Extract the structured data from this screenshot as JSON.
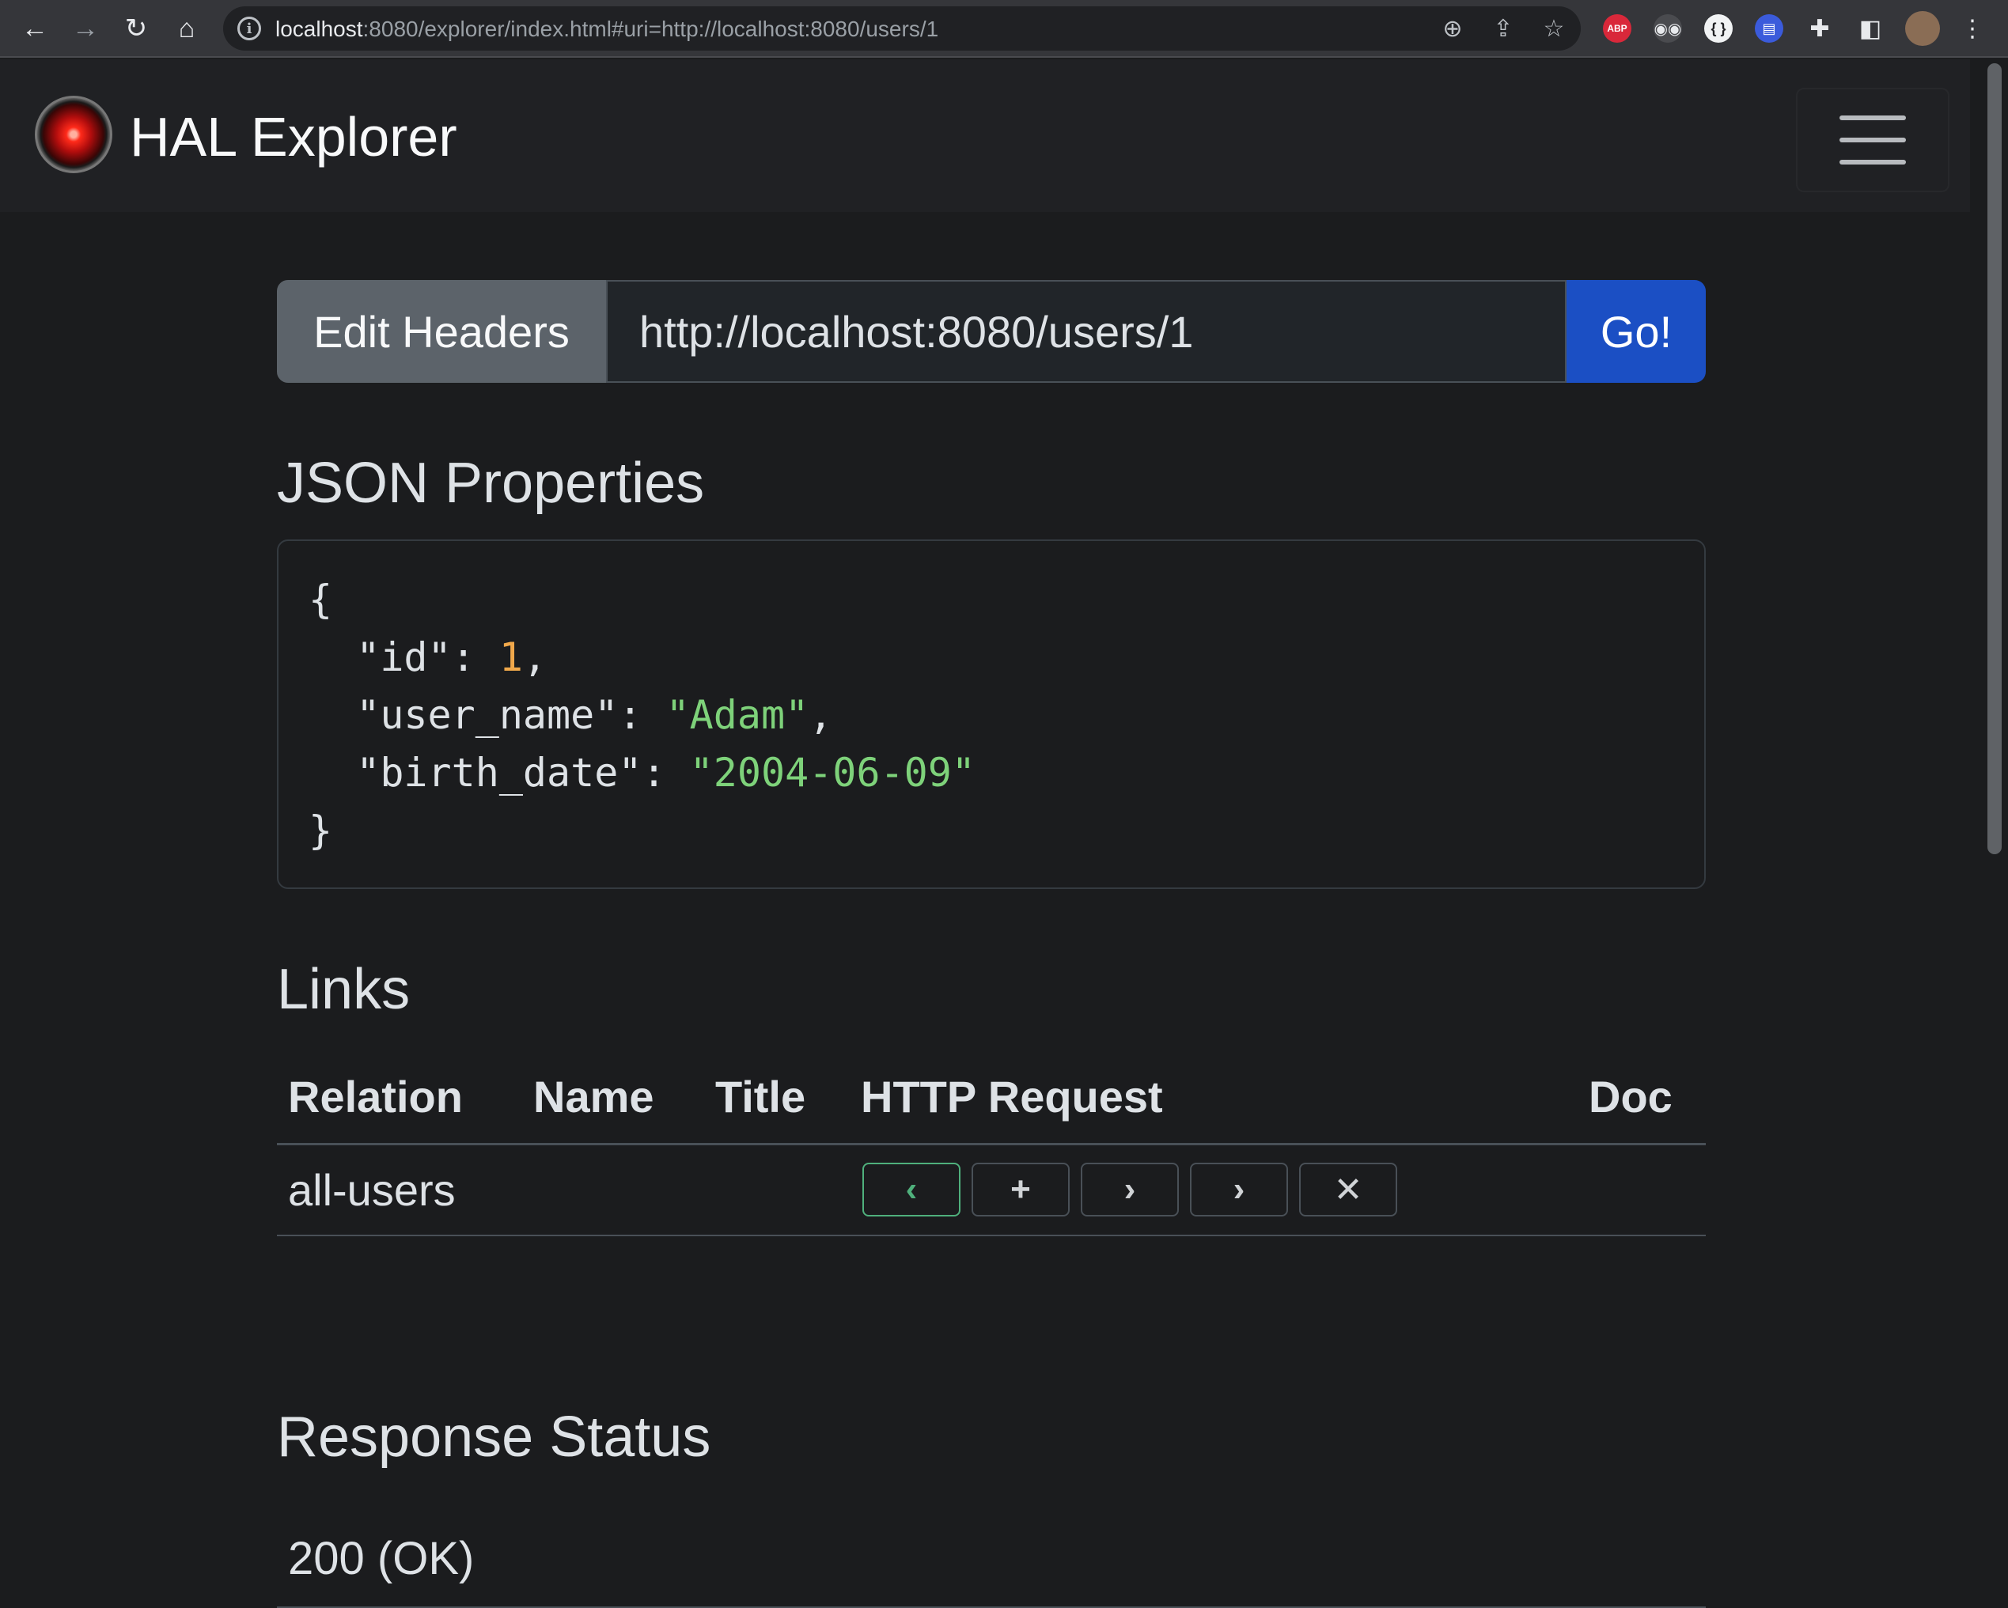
{
  "browser": {
    "url_host": "localhost",
    "url_rest": ":8080/explorer/index.html#uri=http://localhost:8080/users/1",
    "extensions": [
      "ABP"
    ]
  },
  "navbar": {
    "brand": "HAL Explorer",
    "menu_icon": "hamburger-icon"
  },
  "request": {
    "edit_headers_label": "Edit Headers",
    "uri_value": "http://localhost:8080/users/1",
    "go_label": "Go!"
  },
  "json_properties": {
    "heading": "JSON Properties",
    "open_brace": "{",
    "close_brace": "}",
    "fields": [
      {
        "key": "\"id\"",
        "value": "1",
        "type": "number",
        "comma": ","
      },
      {
        "key": "\"user_name\"",
        "value": "\"Adam\"",
        "type": "string",
        "comma": ","
      },
      {
        "key": "\"birth_date\"",
        "value": "\"2004-06-09\"",
        "type": "string",
        "comma": ""
      }
    ]
  },
  "links": {
    "heading": "Links",
    "columns": {
      "relation": "Relation",
      "name": "Name",
      "title": "Title",
      "http_request": "HTTP Request",
      "doc": "Doc"
    },
    "rows": [
      {
        "relation": "all-users",
        "name": "",
        "title": "",
        "doc": ""
      }
    ],
    "request_buttons": [
      {
        "name": "get-button",
        "glyph": "‹",
        "icon": "chevron-left-icon",
        "active": true
      },
      {
        "name": "post-button",
        "glyph": "+",
        "icon": "plus-icon",
        "active": false
      },
      {
        "name": "put-button",
        "glyph": "›",
        "icon": "chevron-right-icon",
        "active": false
      },
      {
        "name": "patch-button",
        "glyph": "›",
        "icon": "chevron-right-icon",
        "active": false
      },
      {
        "name": "delete-button",
        "glyph": "✕",
        "icon": "x-icon",
        "active": false
      }
    ]
  },
  "response_status": {
    "heading": "Response Status",
    "value": "200 (OK)"
  },
  "colors": {
    "go_button": "#1b4fc4",
    "edit_headers_button": "#5c636a",
    "json_number": "#f0a84b",
    "json_string": "#7ed27a",
    "active_request_button": "#4fb07c"
  }
}
